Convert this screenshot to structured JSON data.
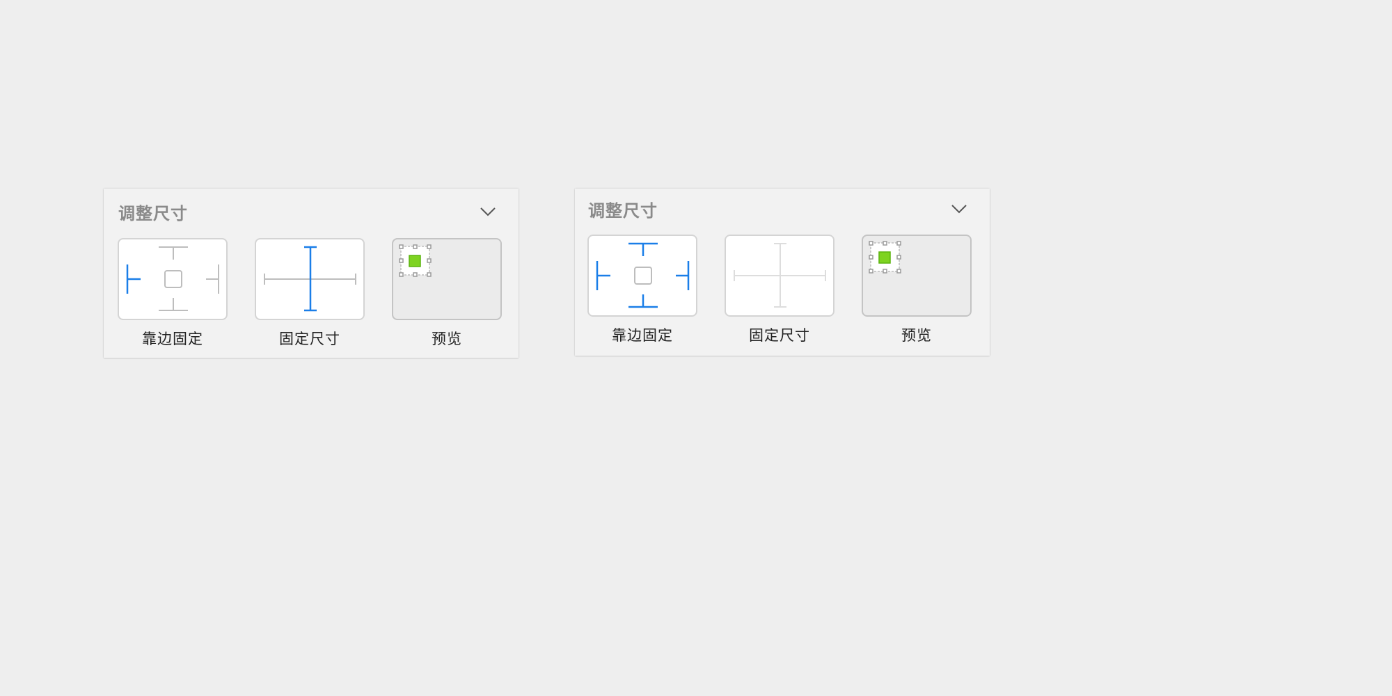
{
  "colors": {
    "active": "#1a7ee8",
    "inactive": "#bdbdbd",
    "disabled": "#dddddd",
    "preview_fill": "#7ed321",
    "preview_stroke": "#5bb40f"
  },
  "panels": [
    {
      "title": "调整尺寸",
      "options": [
        {
          "label": "靠边固定",
          "icon": "pin-edges-icon"
        },
        {
          "label": "固定尺寸",
          "icon": "fixed-size-icon"
        },
        {
          "label": "预览",
          "icon": "preview-icon"
        }
      ]
    },
    {
      "title": "调整尺寸",
      "options": [
        {
          "label": "靠边固定",
          "icon": "pin-edges-icon"
        },
        {
          "label": "固定尺寸",
          "icon": "fixed-size-icon"
        },
        {
          "label": "预览",
          "icon": "preview-icon"
        }
      ]
    }
  ]
}
